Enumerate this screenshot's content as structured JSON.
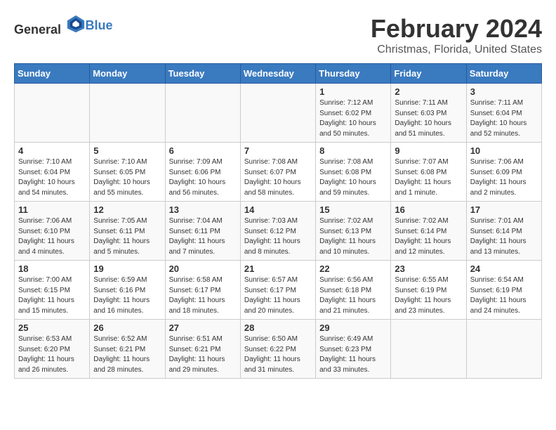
{
  "header": {
    "logo_general": "General",
    "logo_blue": "Blue",
    "month": "February 2024",
    "location": "Christmas, Florida, United States"
  },
  "weekdays": [
    "Sunday",
    "Monday",
    "Tuesday",
    "Wednesday",
    "Thursday",
    "Friday",
    "Saturday"
  ],
  "weeks": [
    [
      {
        "day": "",
        "info": ""
      },
      {
        "day": "",
        "info": ""
      },
      {
        "day": "",
        "info": ""
      },
      {
        "day": "",
        "info": ""
      },
      {
        "day": "1",
        "info": "Sunrise: 7:12 AM\nSunset: 6:02 PM\nDaylight: 10 hours\nand 50 minutes."
      },
      {
        "day": "2",
        "info": "Sunrise: 7:11 AM\nSunset: 6:03 PM\nDaylight: 10 hours\nand 51 minutes."
      },
      {
        "day": "3",
        "info": "Sunrise: 7:11 AM\nSunset: 6:04 PM\nDaylight: 10 hours\nand 52 minutes."
      }
    ],
    [
      {
        "day": "4",
        "info": "Sunrise: 7:10 AM\nSunset: 6:04 PM\nDaylight: 10 hours\nand 54 minutes."
      },
      {
        "day": "5",
        "info": "Sunrise: 7:10 AM\nSunset: 6:05 PM\nDaylight: 10 hours\nand 55 minutes."
      },
      {
        "day": "6",
        "info": "Sunrise: 7:09 AM\nSunset: 6:06 PM\nDaylight: 10 hours\nand 56 minutes."
      },
      {
        "day": "7",
        "info": "Sunrise: 7:08 AM\nSunset: 6:07 PM\nDaylight: 10 hours\nand 58 minutes."
      },
      {
        "day": "8",
        "info": "Sunrise: 7:08 AM\nSunset: 6:08 PM\nDaylight: 10 hours\nand 59 minutes."
      },
      {
        "day": "9",
        "info": "Sunrise: 7:07 AM\nSunset: 6:08 PM\nDaylight: 11 hours\nand 1 minute."
      },
      {
        "day": "10",
        "info": "Sunrise: 7:06 AM\nSunset: 6:09 PM\nDaylight: 11 hours\nand 2 minutes."
      }
    ],
    [
      {
        "day": "11",
        "info": "Sunrise: 7:06 AM\nSunset: 6:10 PM\nDaylight: 11 hours\nand 4 minutes."
      },
      {
        "day": "12",
        "info": "Sunrise: 7:05 AM\nSunset: 6:11 PM\nDaylight: 11 hours\nand 5 minutes."
      },
      {
        "day": "13",
        "info": "Sunrise: 7:04 AM\nSunset: 6:11 PM\nDaylight: 11 hours\nand 7 minutes."
      },
      {
        "day": "14",
        "info": "Sunrise: 7:03 AM\nSunset: 6:12 PM\nDaylight: 11 hours\nand 8 minutes."
      },
      {
        "day": "15",
        "info": "Sunrise: 7:02 AM\nSunset: 6:13 PM\nDaylight: 11 hours\nand 10 minutes."
      },
      {
        "day": "16",
        "info": "Sunrise: 7:02 AM\nSunset: 6:14 PM\nDaylight: 11 hours\nand 12 minutes."
      },
      {
        "day": "17",
        "info": "Sunrise: 7:01 AM\nSunset: 6:14 PM\nDaylight: 11 hours\nand 13 minutes."
      }
    ],
    [
      {
        "day": "18",
        "info": "Sunrise: 7:00 AM\nSunset: 6:15 PM\nDaylight: 11 hours\nand 15 minutes."
      },
      {
        "day": "19",
        "info": "Sunrise: 6:59 AM\nSunset: 6:16 PM\nDaylight: 11 hours\nand 16 minutes."
      },
      {
        "day": "20",
        "info": "Sunrise: 6:58 AM\nSunset: 6:17 PM\nDaylight: 11 hours\nand 18 minutes."
      },
      {
        "day": "21",
        "info": "Sunrise: 6:57 AM\nSunset: 6:17 PM\nDaylight: 11 hours\nand 20 minutes."
      },
      {
        "day": "22",
        "info": "Sunrise: 6:56 AM\nSunset: 6:18 PM\nDaylight: 11 hours\nand 21 minutes."
      },
      {
        "day": "23",
        "info": "Sunrise: 6:55 AM\nSunset: 6:19 PM\nDaylight: 11 hours\nand 23 minutes."
      },
      {
        "day": "24",
        "info": "Sunrise: 6:54 AM\nSunset: 6:19 PM\nDaylight: 11 hours\nand 24 minutes."
      }
    ],
    [
      {
        "day": "25",
        "info": "Sunrise: 6:53 AM\nSunset: 6:20 PM\nDaylight: 11 hours\nand 26 minutes."
      },
      {
        "day": "26",
        "info": "Sunrise: 6:52 AM\nSunset: 6:21 PM\nDaylight: 11 hours\nand 28 minutes."
      },
      {
        "day": "27",
        "info": "Sunrise: 6:51 AM\nSunset: 6:21 PM\nDaylight: 11 hours\nand 29 minutes."
      },
      {
        "day": "28",
        "info": "Sunrise: 6:50 AM\nSunset: 6:22 PM\nDaylight: 11 hours\nand 31 minutes."
      },
      {
        "day": "29",
        "info": "Sunrise: 6:49 AM\nSunset: 6:23 PM\nDaylight: 11 hours\nand 33 minutes."
      },
      {
        "day": "",
        "info": ""
      },
      {
        "day": "",
        "info": ""
      }
    ]
  ]
}
